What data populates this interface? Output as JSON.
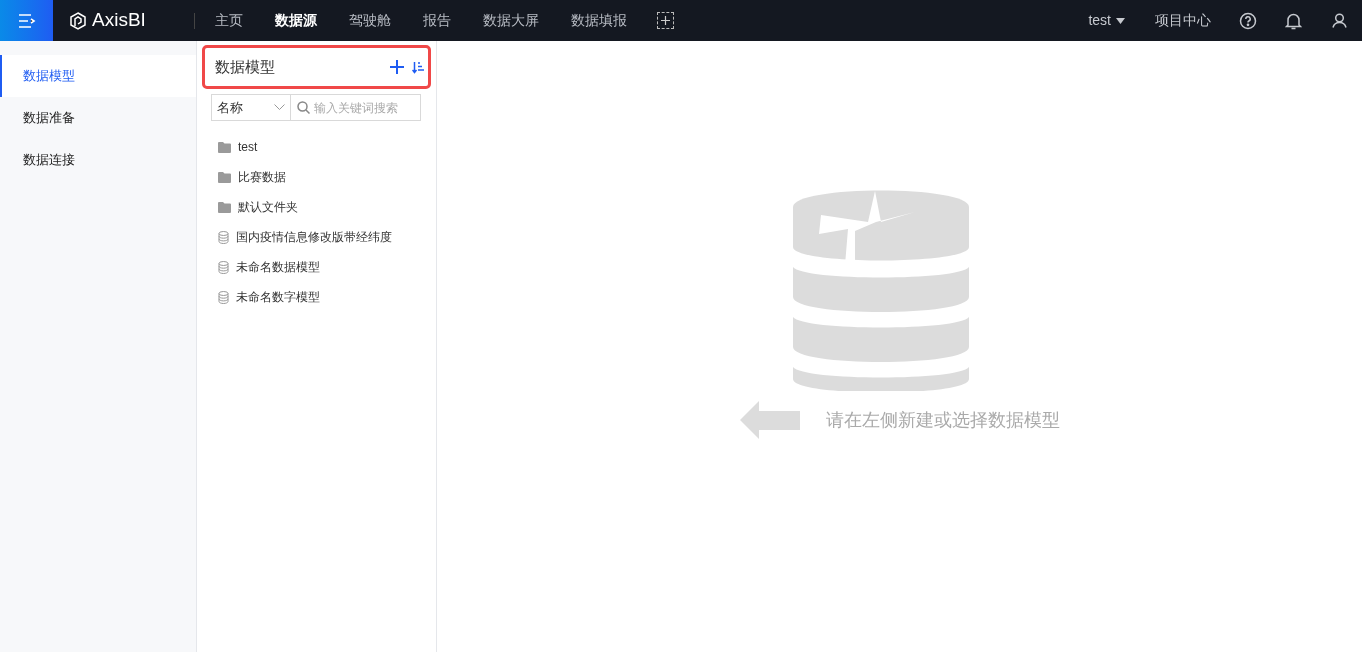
{
  "header": {
    "logo": "AxisBI",
    "nav": [
      {
        "label": "主页",
        "selected": false
      },
      {
        "label": "数据源",
        "selected": true
      },
      {
        "label": "驾驶舱",
        "selected": false
      },
      {
        "label": "报告",
        "selected": false
      },
      {
        "label": "数据大屏",
        "selected": false
      },
      {
        "label": "数据填报",
        "selected": false
      }
    ],
    "user": "test",
    "project_center": "项目中心"
  },
  "sidebar": {
    "items": [
      {
        "label": "数据模型",
        "selected": true
      },
      {
        "label": "数据准备",
        "selected": false
      },
      {
        "label": "数据连接",
        "selected": false
      }
    ]
  },
  "panel": {
    "title": "数据模型",
    "highlighted": true,
    "filter": {
      "value": "名称"
    },
    "search": {
      "placeholder": "输入关键词搜索"
    },
    "tree": [
      {
        "kind": "folder",
        "label": "test"
      },
      {
        "kind": "folder",
        "label": "比赛数据"
      },
      {
        "kind": "folder",
        "label": "默认文件夹"
      },
      {
        "kind": "model",
        "label": "国内疫情信息修改版带经纬度"
      },
      {
        "kind": "model",
        "label": "未命名数据模型"
      },
      {
        "kind": "model",
        "label": "未命名数字模型"
      }
    ]
  },
  "empty_state": {
    "message": "请在左侧新建或选择数据模型"
  }
}
